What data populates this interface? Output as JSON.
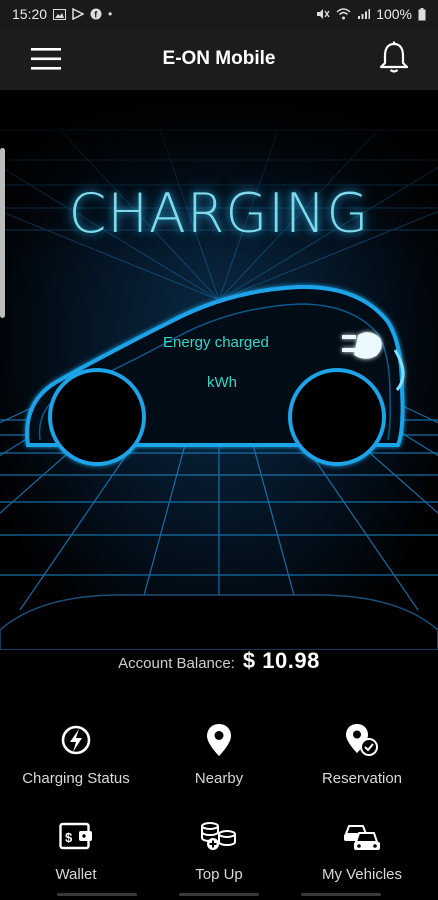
{
  "status_bar": {
    "time": "15:20",
    "battery": "100%"
  },
  "app_bar": {
    "title": "E-ON Mobile"
  },
  "hero": {
    "title": "CHARGING",
    "energy_label": "Energy charged",
    "energy_unit": "kWh"
  },
  "account": {
    "label": "Account Balance:",
    "value": "$ 10.98"
  },
  "actions": [
    {
      "label": "Charging Status",
      "icon": "charging-status-icon"
    },
    {
      "label": "Nearby",
      "icon": "location-pin-icon"
    },
    {
      "label": "Reservation",
      "icon": "reservation-icon"
    },
    {
      "label": "Wallet",
      "icon": "wallet-icon"
    },
    {
      "label": "Top Up",
      "icon": "top-up-icon"
    },
    {
      "label": "My Vehicles",
      "icon": "vehicles-icon"
    }
  ],
  "colors": {
    "accent": "#39d6c8",
    "glow": "#2aa7d6",
    "background": "#000000",
    "appbar": "#1c1c1c"
  }
}
